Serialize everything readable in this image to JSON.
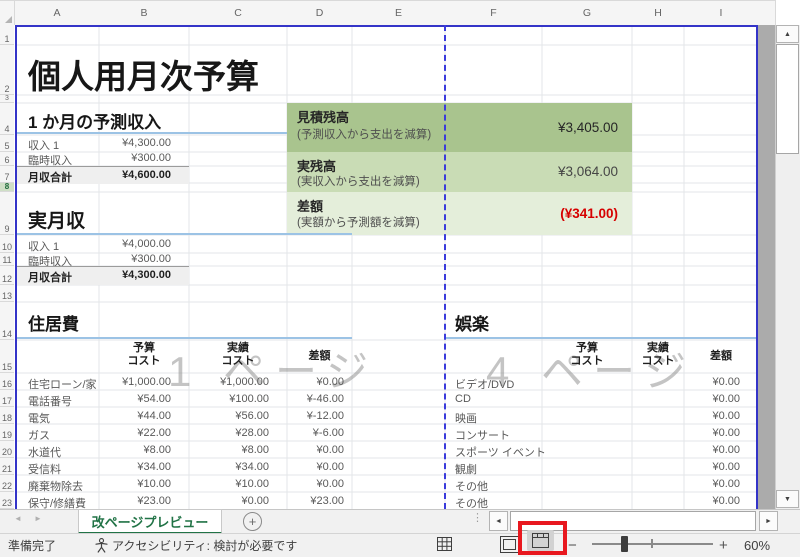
{
  "title": "個人用月次予算",
  "grid": {
    "column_letters": [
      "A",
      "B",
      "C",
      "D",
      "E",
      "F",
      "G",
      "H",
      "I"
    ],
    "row_numbers": [
      "1",
      "2",
      "3",
      "4",
      "5",
      "6",
      "7",
      "8",
      "9",
      "10",
      "11",
      "12",
      "13",
      "14",
      "15",
      "16",
      "17",
      "18",
      "19",
      "20",
      "21",
      "22",
      "23"
    ]
  },
  "expected_income": {
    "header": "1 か月の予測収入",
    "rows": [
      {
        "label": "収入 1",
        "value": "¥4,300.00"
      },
      {
        "label": "臨時収入",
        "value": "¥300.00"
      }
    ],
    "total": {
      "label": "月収合計",
      "value": "¥4,600.00"
    }
  },
  "actual_income": {
    "header": "実月収",
    "rows": [
      {
        "label": "収入 1",
        "value": "¥4,000.00"
      },
      {
        "label": "臨時収入",
        "value": "¥300.00"
      }
    ],
    "total": {
      "label": "月収合計",
      "value": "¥4,300.00"
    }
  },
  "summary": {
    "items": [
      {
        "title": "見積残高",
        "subtitle": "(予測収入から支出を減算)",
        "value": "¥3,405.00"
      },
      {
        "title": "実残高",
        "subtitle": "(実収入から支出を減算)",
        "value": "¥3,064.00"
      },
      {
        "title": "差額",
        "subtitle": "(実額から予測額を減算)",
        "value": "(¥341.00)"
      }
    ]
  },
  "housing": {
    "header": "住居費",
    "col_headers": [
      {
        "line1": "予算",
        "line2": "コスト"
      },
      {
        "line1": "実績",
        "line2": "コスト"
      },
      {
        "line1": "差額",
        "line2": ""
      }
    ],
    "rows": [
      {
        "name": "住宅ローン/家",
        "budget": "¥1,000.00",
        "actual": "¥1,000.00",
        "diff": "¥0.00"
      },
      {
        "name": "電話番号",
        "budget": "¥54.00",
        "actual": "¥100.00",
        "diff": "¥-46.00"
      },
      {
        "name": "電気",
        "budget": "¥44.00",
        "actual": "¥56.00",
        "diff": "¥-12.00"
      },
      {
        "name": "ガス",
        "budget": "¥22.00",
        "actual": "¥28.00",
        "diff": "¥-6.00"
      },
      {
        "name": "水道代",
        "budget": "¥8.00",
        "actual": "¥8.00",
        "diff": "¥0.00"
      },
      {
        "name": "受信料",
        "budget": "¥34.00",
        "actual": "¥34.00",
        "diff": "¥0.00"
      },
      {
        "name": "廃棄物除去",
        "budget": "¥10.00",
        "actual": "¥10.00",
        "diff": "¥0.00"
      },
      {
        "name": "保守/修繕費",
        "budget": "¥23.00",
        "actual": "¥0.00",
        "diff": "¥23.00"
      }
    ]
  },
  "entertainment": {
    "header": "娯楽",
    "col_headers": [
      {
        "line1": "予算",
        "line2": "コスト"
      },
      {
        "line1": "実績",
        "line2": "コスト"
      },
      {
        "line1": "差額",
        "line2": ""
      }
    ],
    "rows": [
      {
        "name": "ビデオ/DVD",
        "diff": "¥0.00"
      },
      {
        "name": "CD",
        "diff": "¥0.00"
      },
      {
        "name": "映画",
        "diff": "¥0.00"
      },
      {
        "name": "コンサート",
        "diff": "¥0.00"
      },
      {
        "name": "スポーツ イベント",
        "diff": "¥0.00"
      },
      {
        "name": "観劇",
        "diff": "¥0.00"
      },
      {
        "name": "その他",
        "diff": "¥0.00"
      },
      {
        "name": "その他",
        "diff": "¥0.00"
      }
    ]
  },
  "watermarks": {
    "page1": "1 ページ",
    "page4": "4 ページ"
  },
  "sheet_tabs": {
    "active": "改ページプレビュー"
  },
  "status": {
    "ready": "準備完了",
    "accessibility": "アクセシビリティ: 検討が必要です",
    "zoom_level": "60%"
  },
  "icons": {
    "select_all": "select-all-corner",
    "tab_nav": [
      "tab-scroll-left-icon",
      "tab-scroll-right-icon"
    ],
    "add_sheet": "plus-circle-icon",
    "accessibility": "accessibility-person-icon",
    "views": [
      "normal-view-icon",
      "page-layout-view-icon",
      "page-break-preview-icon"
    ],
    "zoom": [
      "zoom-out-icon",
      "zoom-slider",
      "zoom-in-icon"
    ]
  },
  "colors": {
    "summary_green_dark": "#a9c48e",
    "summary_green_mid": "#c9dcb5",
    "summary_green_light": "#e4eeda",
    "negative_red": "#d60000",
    "tab_green": "#217346",
    "page_break_blue": "#3434c8",
    "annotation_red": "#e8181f",
    "section_underline_blue": "#9cc3e5"
  }
}
